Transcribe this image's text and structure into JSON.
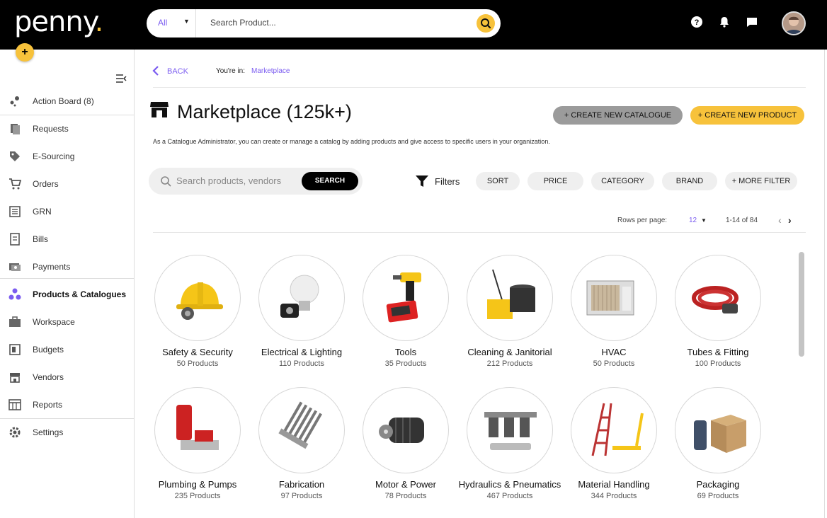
{
  "topbar": {
    "logo": "penny",
    "logo_dot": ".",
    "fab_label": "+",
    "search": {
      "scope": "All",
      "placeholder": "Search Product..."
    },
    "icons": [
      "help-icon",
      "bell-icon",
      "chat-icon"
    ]
  },
  "sidebar": {
    "items": [
      {
        "label": "Action Board (8)",
        "icon": "action-board-icon"
      },
      {
        "label": "Requests",
        "icon": "requests-icon"
      },
      {
        "label": "E-Sourcing",
        "icon": "tag-icon"
      },
      {
        "label": "Orders",
        "icon": "cart-icon"
      },
      {
        "label": "GRN",
        "icon": "grn-icon"
      },
      {
        "label": "Bills",
        "icon": "bill-icon"
      },
      {
        "label": "Payments",
        "icon": "payments-icon"
      },
      {
        "label": "Products & Catalogues",
        "icon": "products-icon",
        "active": true
      },
      {
        "label": "Workspace",
        "icon": "briefcase-icon"
      },
      {
        "label": "Budgets",
        "icon": "budgets-icon"
      },
      {
        "label": "Vendors",
        "icon": "store-icon"
      },
      {
        "label": "Reports",
        "icon": "reports-icon"
      },
      {
        "label": "Settings",
        "icon": "gear-icon"
      }
    ]
  },
  "header": {
    "back_label": "BACK",
    "youre_in": "You're in:",
    "breadcrumb": "Marketplace",
    "title": "Marketplace (125k+)",
    "create_catalogue": "+ CREATE NEW CATALOGUE",
    "create_product": "+ CREATE NEW PRODUCT",
    "description": "As a Catalogue Administrator, you can create or manage a catalog by adding products and give access to specific users in your organization."
  },
  "search": {
    "placeholder": "Search products, vendors",
    "button": "SEARCH"
  },
  "filters": {
    "label": "Filters",
    "chips": [
      "SORT",
      "PRICE",
      "CATEGORY",
      "BRAND",
      "+ MORE FILTER"
    ]
  },
  "pagination": {
    "rows_label": "Rows per page:",
    "rows_value": "12",
    "range": "1-14 of 84"
  },
  "categories": [
    {
      "name": "Safety & Security",
      "count": "50 Products",
      "icon": "hard-hat-icon"
    },
    {
      "name": "Electrical & Lighting",
      "count": "110 Products",
      "icon": "light-bulb-icon"
    },
    {
      "name": "Tools",
      "count": "35 Products",
      "icon": "drill-icon"
    },
    {
      "name": "Cleaning & Janitorial",
      "count": "212 Products",
      "icon": "mop-bucket-icon"
    },
    {
      "name": "HVAC",
      "count": "50 Products",
      "icon": "air-conditioner-icon"
    },
    {
      "name": "Tubes & Fitting",
      "count": "100 Products",
      "icon": "hose-icon"
    },
    {
      "name": "Plumbing & Pumps",
      "count": "235 Products",
      "icon": "pump-icon"
    },
    {
      "name": "Fabrication",
      "count": "97 Products",
      "icon": "heat-sink-icon"
    },
    {
      "name": "Motor & Power",
      "count": "78 Products",
      "icon": "motor-icon"
    },
    {
      "name": "Hydraulics & Pneumatics",
      "count": "467 Products",
      "icon": "filter-regulator-icon"
    },
    {
      "name": "Material Handling",
      "count": "344 Products",
      "icon": "ladder-pallet-jack-icon"
    },
    {
      "name": "Packaging",
      "count": "69 Products",
      "icon": "box-icon"
    }
  ]
}
